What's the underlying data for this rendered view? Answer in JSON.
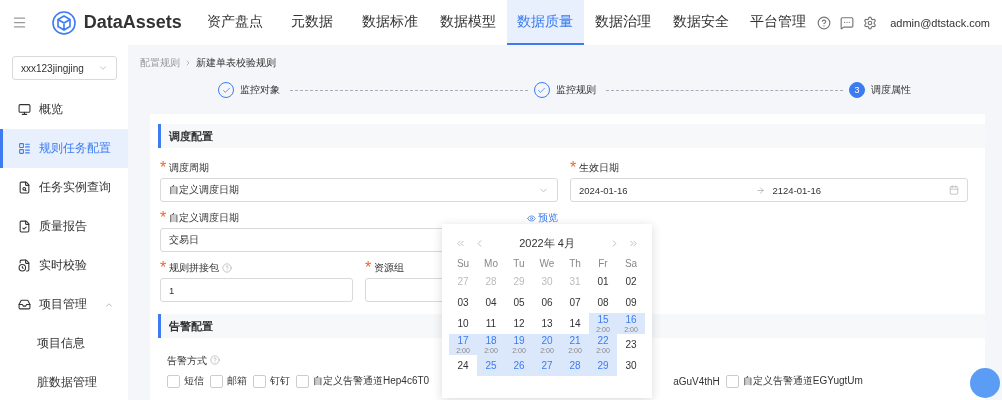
{
  "nav": {
    "brand": "DataAssets",
    "user": "admin@dtstack.com",
    "items": [
      {
        "label": "资产盘点",
        "selected": false
      },
      {
        "label": "元数据",
        "selected": false
      },
      {
        "label": "数据标准",
        "selected": false
      },
      {
        "label": "数据模型",
        "selected": false
      },
      {
        "label": "数据质量",
        "selected": true
      },
      {
        "label": "数据治理",
        "selected": false
      },
      {
        "label": "数据安全",
        "selected": false
      },
      {
        "label": "平台管理",
        "selected": false
      }
    ]
  },
  "sidebar": {
    "project_select": "xxx123jingjing",
    "items": [
      {
        "label": "概览",
        "selected": false
      },
      {
        "label": "规则任务配置",
        "selected": true
      },
      {
        "label": "任务实例查询",
        "selected": false
      },
      {
        "label": "质量报告",
        "selected": false
      },
      {
        "label": "实时校验",
        "selected": false
      },
      {
        "label": "项目管理",
        "selected": false,
        "expanded": true,
        "children": [
          {
            "label": "项目信息",
            "selected": false
          },
          {
            "label": "脏数据管理",
            "selected": false
          }
        ]
      }
    ]
  },
  "breadcrumb": [
    "配置规则",
    "新建单表校验规则"
  ],
  "steps": [
    {
      "label": "监控对象",
      "done": true
    },
    {
      "label": "监控规则",
      "done": true
    },
    {
      "label": "调度属性",
      "done": false,
      "number": "3"
    }
  ],
  "schedule_section": {
    "title": "调度配置",
    "rows": [
      [
        {
          "kind": "select",
          "label": "调度周期",
          "required_mark": "*",
          "value": "自定义调度日期"
        },
        {
          "kind": "date_range",
          "label": "生效日期",
          "required_mark": "*",
          "start": "2024-01-16",
          "end": "2124-01-16"
        }
      ],
      [
        {
          "kind": "input",
          "label": "自定义调度日期",
          "required_mark": "*",
          "value": "交易日",
          "link": "预览"
        }
      ],
      [
        {
          "kind": "input",
          "label": "规则拼接包",
          "required_mark": "*",
          "help": true,
          "value": "1"
        },
        {
          "kind": "input",
          "label": "资源组",
          "required_mark": "*"
        }
      ]
    ]
  },
  "alert_section": {
    "title": "告警配置",
    "label": "告警方式",
    "help": true,
    "options": [
      {
        "kind": "checkbox",
        "label": "短信",
        "checked": false
      },
      {
        "kind": "checkbox",
        "label": "邮箱",
        "checked": false
      },
      {
        "kind": "checkbox",
        "label": "钉钉",
        "checked": false
      },
      {
        "kind": "checkbox",
        "label": "自定义告警通道Hep4c6T0",
        "checked": false
      },
      {
        "kind": "fragment",
        "label": "aGuV4thH"
      },
      {
        "kind": "checkbox",
        "label": "自定义告警通道EGYugtUm",
        "checked": false
      }
    ]
  },
  "calendar": {
    "title": "2022年 4月",
    "weekdays": [
      "Su",
      "Mo",
      "Tu",
      "We",
      "Th",
      "Fr",
      "Sa"
    ],
    "weeks": [
      [
        {
          "day": "27",
          "outside": true,
          "selected": false
        },
        {
          "day": "28",
          "outside": true,
          "selected": false
        },
        {
          "day": "29",
          "outside": true,
          "selected": false
        },
        {
          "day": "30",
          "outside": true,
          "selected": false
        },
        {
          "day": "31",
          "outside": true,
          "selected": false
        },
        {
          "day": "01",
          "outside": false,
          "selected": false
        },
        {
          "day": "02",
          "outside": false,
          "selected": false
        }
      ],
      [
        {
          "day": "03",
          "outside": false,
          "selected": false
        },
        {
          "day": "04",
          "outside": false,
          "selected": false
        },
        {
          "day": "05",
          "outside": false,
          "selected": false
        },
        {
          "day": "06",
          "outside": false,
          "selected": false
        },
        {
          "day": "07",
          "outside": false,
          "selected": false
        },
        {
          "day": "08",
          "outside": false,
          "selected": false
        },
        {
          "day": "09",
          "outside": false,
          "selected": false
        }
      ],
      [
        {
          "day": "10",
          "outside": false,
          "selected": false
        },
        {
          "day": "11",
          "outside": false,
          "selected": false
        },
        {
          "day": "12",
          "outside": false,
          "selected": false
        },
        {
          "day": "13",
          "outside": false,
          "selected": false
        },
        {
          "day": "14",
          "outside": false,
          "selected": false
        },
        {
          "day": "15",
          "sub": "2:00",
          "outside": false,
          "selected": true
        },
        {
          "day": "16",
          "sub": "2:00",
          "outside": false,
          "selected": true
        }
      ],
      [
        {
          "day": "17",
          "sub": "2:00",
          "outside": false,
          "selected": true
        },
        {
          "day": "18",
          "sub": "2:00",
          "outside": false,
          "selected": true
        },
        {
          "day": "19",
          "sub": "2:00",
          "outside": false,
          "selected": true
        },
        {
          "day": "20",
          "sub": "2:00",
          "outside": false,
          "selected": true
        },
        {
          "day": "21",
          "sub": "2:00",
          "outside": false,
          "selected": true
        },
        {
          "day": "22",
          "sub": "2:00",
          "outside": false,
          "selected": true
        },
        {
          "day": "23",
          "outside": false,
          "selected": false
        }
      ],
      [
        {
          "day": "24",
          "outside": false,
          "selected": false
        },
        {
          "day": "25",
          "outside": false,
          "selected": true
        },
        {
          "day": "26",
          "outside": false,
          "selected": true
        },
        {
          "day": "27",
          "outside": false,
          "selected": true
        },
        {
          "day": "28",
          "outside": false,
          "selected": true
        },
        {
          "day": "29",
          "outside": false,
          "selected": true
        },
        {
          "day": "30",
          "outside": false,
          "selected": false
        }
      ]
    ]
  }
}
